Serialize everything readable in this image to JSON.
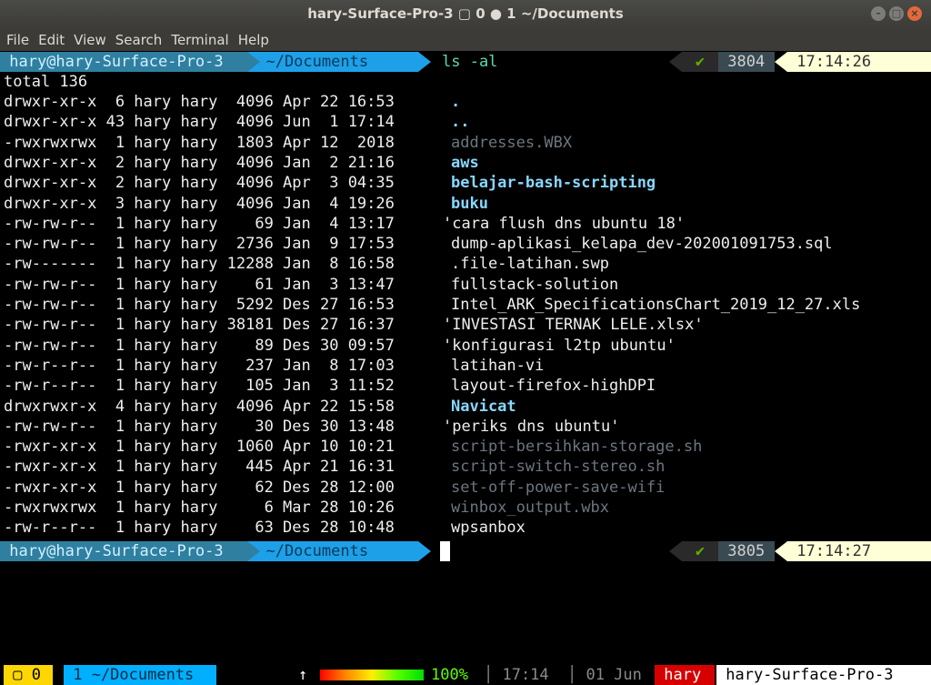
{
  "window": {
    "title": "hary-Surface-Pro-3 ▢ 0 ● 1 ~/Documents"
  },
  "menu": [
    "File",
    "Edit",
    "View",
    "Search",
    "Terminal",
    "Help"
  ],
  "prompt1": {
    "user": " hary@hary-Surface-Pro-3 ",
    "dir": "  ~/Documents ",
    "cmd": "ls -al",
    "check": "✔",
    "num": " 3804 ",
    "time": " 17:14:26 "
  },
  "total": "total 136",
  "listing": [
    {
      "meta": "drwxr-xr-x  6 hary hary  4096 Apr 22 16:53",
      "name": ".",
      "kind": "dir"
    },
    {
      "meta": "drwxr-xr-x 43 hary hary  4096 Jun  1 17:14",
      "name": "..",
      "kind": "dir"
    },
    {
      "meta": "-rwxrwxrwx  1 hary hary  1803 Apr 12  2018",
      "name": "addresses.WBX",
      "kind": "exec"
    },
    {
      "meta": "drwxr-xr-x  2 hary hary  4096 Jan  2 21:16",
      "name": "aws",
      "kind": "dir"
    },
    {
      "meta": "drwxr-xr-x  2 hary hary  4096 Apr  3 04:35",
      "name": "belajar-bash-scripting",
      "kind": "dir"
    },
    {
      "meta": "drwxr-xr-x  3 hary hary  4096 Jan  4 19:26",
      "name": "buku",
      "kind": "dir"
    },
    {
      "meta": "-rw-rw-r--  1 hary hary    69 Jan  4 13:17",
      "name": "'cara flush dns ubuntu 18'",
      "kind": "quote"
    },
    {
      "meta": "-rw-rw-r--  1 hary hary  2736 Jan  9 17:53",
      "name": "dump-aplikasi_kelapa_dev-202001091753.sql",
      "kind": "plain"
    },
    {
      "meta": "-rw-------  1 hary hary 12288 Jan  8 16:58",
      "name": ".file-latihan.swp",
      "kind": "plain"
    },
    {
      "meta": "-rw-rw-r--  1 hary hary    61 Jan  3 13:47",
      "name": "fullstack-solution",
      "kind": "plain"
    },
    {
      "meta": "-rw-rw-r--  1 hary hary  5292 Des 27 16:53",
      "name": "Intel_ARK_SpecificationsChart_2019_12_27.xls",
      "kind": "plain"
    },
    {
      "meta": "-rw-rw-r--  1 hary hary 38181 Des 27 16:37",
      "name": "'INVESTASI TERNAK LELE.xlsx'",
      "kind": "quote"
    },
    {
      "meta": "-rw-rw-r--  1 hary hary    89 Des 30 09:57",
      "name": "'konfigurasi l2tp ubuntu'",
      "kind": "quote"
    },
    {
      "meta": "-rw-r--r--  1 hary hary   237 Jan  8 17:03",
      "name": "latihan-vi",
      "kind": "plain"
    },
    {
      "meta": "-rw-r--r--  1 hary hary   105 Jan  3 11:52",
      "name": "layout-firefox-highDPI",
      "kind": "plain"
    },
    {
      "meta": "drwxrwxr-x  4 hary hary  4096 Apr 22 15:58",
      "name": "Navicat",
      "kind": "dir"
    },
    {
      "meta": "-rw-rw-r--  1 hary hary    30 Des 30 13:48",
      "name": "'periks dns ubuntu'",
      "kind": "quote"
    },
    {
      "meta": "-rwxr-xr-x  1 hary hary  1060 Apr 10 10:21",
      "name": "script-bersihkan-storage.sh",
      "kind": "exec"
    },
    {
      "meta": "-rwxr-xr-x  1 hary hary   445 Apr 21 16:31",
      "name": "script-switch-stereo.sh",
      "kind": "exec"
    },
    {
      "meta": "-rwxr-xr-x  1 hary hary    62 Des 28 12:00",
      "name": "set-off-power-save-wifi",
      "kind": "exec"
    },
    {
      "meta": "-rwxrwxrwx  1 hary hary     6 Mar 28 10:26",
      "name": "winbox_output.wbx",
      "kind": "exec"
    },
    {
      "meta": "-rw-r--r--  1 hary hary    63 Des 28 10:48",
      "name": "wpsanbox",
      "kind": "plain"
    }
  ],
  "prompt2": {
    "user": " hary@hary-Surface-Pro-3 ",
    "dir": "  ~/Documents ",
    "check": "✔",
    "num": " 3805 ",
    "time": " 17:14:27 "
  },
  "statusbar": {
    "session": " ▢ 0 ",
    "window": " 1 ~/Documents ",
    "up": "↑",
    "battery_pct": "100%",
    "time": "│ 17:14 ",
    "date": "│ 01 Jun ",
    "user": " hary ",
    "host": " hary-Surface-Pro-3 "
  },
  "colors": {
    "prompt_user_bg": "#2f7fa0",
    "prompt_dir_bg": "#1ea0e8",
    "prompt_num_bg": "#3a4a52",
    "prompt_time_bg": "#ffffd7",
    "dir_fg": "#87d7ff",
    "exec_fg": "#6c7680",
    "status_session_bg": "#ffd700",
    "status_window_bg": "#00afff",
    "status_user_bg": "#d70000"
  }
}
